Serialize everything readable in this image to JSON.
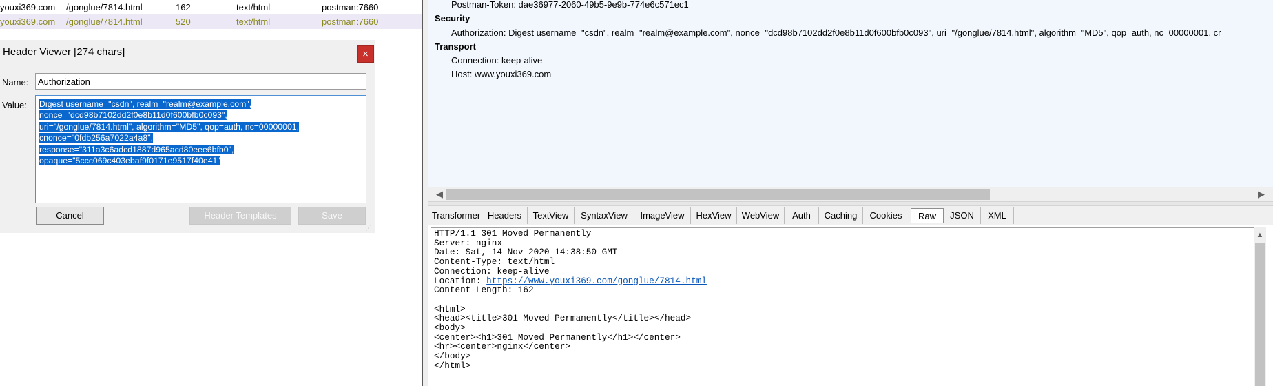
{
  "session_list": {
    "rows": [
      {
        "host": "youxi369.com",
        "url": "/gonglue/7814.html",
        "body": "162",
        "content_type": "text/html",
        "process": "postman:7660"
      },
      {
        "host": "youxi369.com",
        "url": "/gonglue/7814.html",
        "body": "520",
        "content_type": "text/html",
        "process": "postman:7660"
      }
    ]
  },
  "dialog": {
    "title": "Header Viewer [274 chars]",
    "close_label": "×",
    "name_label": "Name:",
    "name_value": "Authorization",
    "value_label": "Value:",
    "value_lines": [
      "Digest username=\"csdn\", realm=\"realm@example.com\",",
      "nonce=\"dcd98b7102dd2f0e8b11d0f600bfb0c093\",",
      "uri=\"/gonglue/7814.html\", algorithm=\"MD5\", qop=auth, nc=00000001,",
      "cnonce=\"0fdb256a7022a4a8\",",
      "response=\"311a3c6adcd1887d965acd80eee6bfb0\",",
      "opaque=\"5ccc069c403ebaf9f0171e9517f40e41\""
    ],
    "cancel_label": "Cancel",
    "templates_label": "Header Templates",
    "save_label": "Save"
  },
  "request_headers": {
    "partial_top": "Postman-Token: dae36977-2060-49b5-9e9b-774e6c571ec1",
    "security_group": "Security",
    "authorization": "Authorization: Digest username=\"csdn\", realm=\"realm@example.com\", nonce=\"dcd98b7102dd2f0e8b11d0f600bfb0c093\", uri=\"/gonglue/7814.html\", algorithm=\"MD5\", qop=auth, nc=00000001, cr",
    "transport_group": "Transport",
    "connection": "Connection: keep-alive",
    "host": "Host: www.youxi369.com"
  },
  "tabs": [
    {
      "label": "Transformer"
    },
    {
      "label": "Headers"
    },
    {
      "label": "TextView"
    },
    {
      "label": "SyntaxView"
    },
    {
      "label": "ImageView"
    },
    {
      "label": "HexView"
    },
    {
      "label": "WebView"
    },
    {
      "label": "Auth"
    },
    {
      "label": "Caching"
    },
    {
      "label": "Cookies"
    },
    {
      "label": "Raw",
      "active": true
    },
    {
      "label": "JSON"
    },
    {
      "label": "XML"
    }
  ],
  "response": {
    "status_line": "HTTP/1.1 301 Moved Permanently",
    "server": "Server: nginx",
    "date": "Date: Sat, 14 Nov 2020 14:38:50 GMT",
    "content_type": "Content-Type: text/html",
    "connection": "Connection: keep-alive",
    "location_label": "Location: ",
    "location_url": "https://www.youxi369.com/gonglue/7814.html",
    "content_length": "Content-Length: 162",
    "body_lines": [
      "<html>",
      "<head><title>301 Moved Permanently</title></head>",
      "<body>",
      "<center><h1>301 Moved Permanently</h1></center>",
      "<hr><center>nginx</center>",
      "</body>",
      "</html>"
    ]
  },
  "icons": {
    "scroll_left": "◀",
    "scroll_right": "▶",
    "scroll_up": "▲",
    "resize_grip": "⋰"
  }
}
